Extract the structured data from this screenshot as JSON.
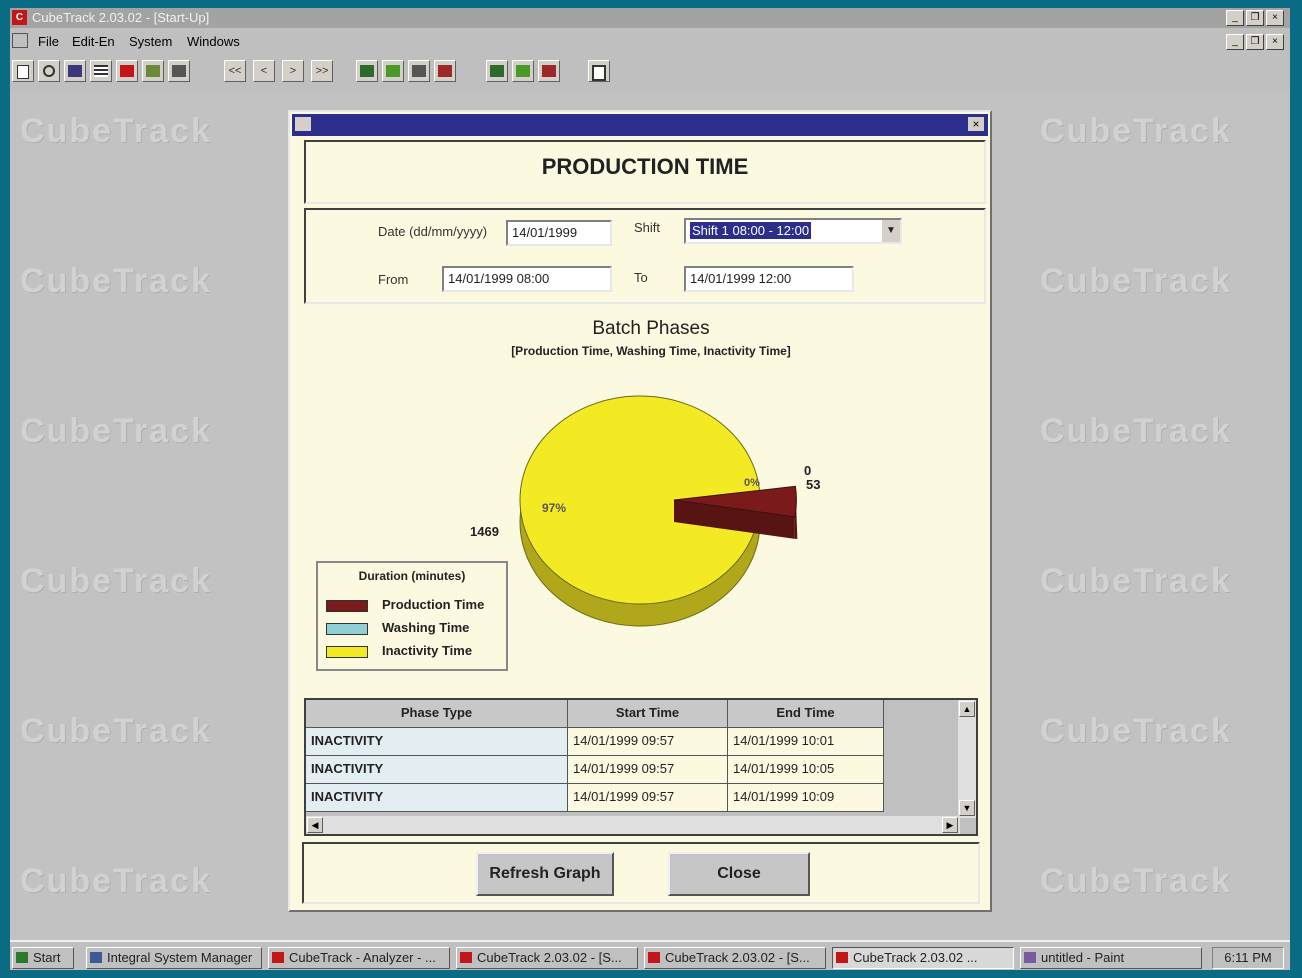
{
  "window": {
    "title": "CubeTrack 2.03.02 - [Start-Up]"
  },
  "menu": {
    "file": "File",
    "edit": "Edit-En",
    "system": "System",
    "windows": "Windows"
  },
  "toolbar": {
    "first": "<<",
    "prev": "<",
    "next": ">",
    "last": ">>"
  },
  "background": {
    "watermark": "CubeTrack"
  },
  "dialog": {
    "heading": "PRODUCTION TIME",
    "date_label": "Date (dd/mm/yyyy)",
    "date_value": "14/01/1999",
    "shift_label": "Shift",
    "shift_value": "Shift 1 08:00 - 12:00",
    "from_label": "From",
    "from_value": "14/01/1999 08:00",
    "to_label": "To",
    "to_value": "14/01/1999 12:00",
    "refresh_button": "Refresh Graph",
    "close_button": "Close"
  },
  "chart_data": {
    "type": "pie",
    "title": "Batch Phases",
    "subtitle": "[Production Time, Washing Time, Inactivity Time]",
    "legend_title": "Duration (minutes)",
    "legend_position": "bottom-left",
    "series": [
      {
        "name": "Production Time",
        "value": 53,
        "color": "#7a1a1a",
        "label": "53"
      },
      {
        "name": "Washing Time",
        "value": 0,
        "color": "#8fd0d6",
        "label": "0"
      },
      {
        "name": "Inactivity Time",
        "value": 1469,
        "color": "#f4ea24",
        "label": "1469"
      }
    ],
    "slice_labels": [
      "97%",
      "0%"
    ]
  },
  "table": {
    "headers": [
      "Phase Type",
      "Start Time",
      "End Time"
    ],
    "rows": [
      [
        "INACTIVITY",
        "14/01/1999 09:57",
        "14/01/1999 10:01"
      ],
      [
        "INACTIVITY",
        "14/01/1999 09:57",
        "14/01/1999 10:05"
      ],
      [
        "INACTIVITY",
        "14/01/1999 09:57",
        "14/01/1999 10:09"
      ]
    ]
  },
  "taskbar": {
    "start": "Start",
    "items": [
      "Integral System Manager",
      "CubeTrack - Analyzer - ...",
      "CubeTrack 2.03.02 - [S...",
      "CubeTrack 2.03.02 - [S...",
      "CubeTrack 2.03.02 ...",
      "untitled - Paint"
    ],
    "clock": "6:11 PM"
  }
}
